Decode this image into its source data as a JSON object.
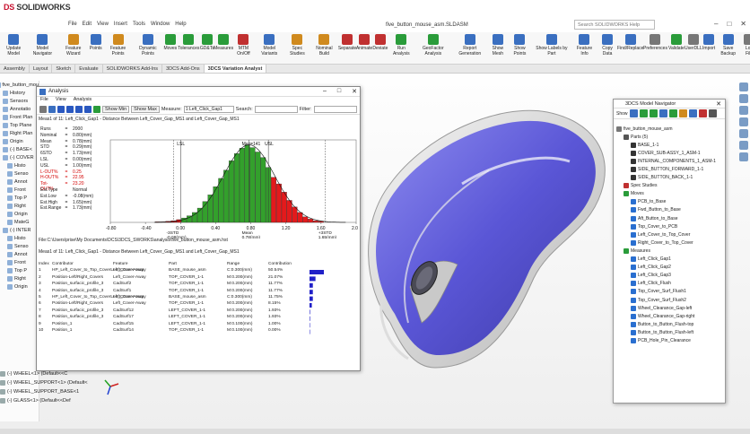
{
  "app": {
    "brand": "SOLIDWORKS",
    "doc_title": "five_button_mouse_asm.SLDASM",
    "search_placeholder": "Search SOLIDWORKS Help"
  },
  "menu": [
    "File",
    "Edit",
    "View",
    "Insert",
    "Tools",
    "Window",
    "Help"
  ],
  "ribbon": [
    {
      "label": "Update Model",
      "icon": "update-icon",
      "color": "#3a6fc0"
    },
    {
      "label": "Model Navigator",
      "icon": "navigator-icon",
      "color": "#3a6fc0"
    },
    {
      "label": "Feature Wizard",
      "icon": "wizard-icon",
      "color": "#d08a1e"
    },
    {
      "label": "Points",
      "icon": "points-icon",
      "color": "#3a6fc0"
    },
    {
      "label": "Feature Points",
      "icon": "feature-points-icon",
      "color": "#d08a1e"
    },
    {
      "label": "Dynamic Points",
      "icon": "dynamic-points-icon",
      "color": "#3a6fc0"
    },
    {
      "label": "Moves",
      "icon": "moves-icon",
      "color": "#2a9c3a"
    },
    {
      "label": "Tolerances",
      "icon": "tolerances-icon",
      "color": "#2a9c3a"
    },
    {
      "label": "GD&Ts",
      "icon": "gdt-icon",
      "color": "#2a9c3a"
    },
    {
      "label": "Measures",
      "icon": "measures-icon",
      "color": "#2a9c3a"
    },
    {
      "label": "MTM On/Off",
      "icon": "mtm-icon",
      "color": "#c03030"
    },
    {
      "label": "Model Variants",
      "icon": "variants-icon",
      "color": "#3a6fc0"
    },
    {
      "label": "Spec Studies",
      "icon": "spec-icon",
      "color": "#d08a1e"
    },
    {
      "label": "Nominal Build",
      "icon": "nominal-icon",
      "color": "#d08a1e"
    },
    {
      "label": "Separate",
      "icon": "separate-icon",
      "color": "#c03030"
    },
    {
      "label": "Animate",
      "icon": "animate-icon",
      "color": "#c03030"
    },
    {
      "label": "Deviate",
      "icon": "deviate-icon",
      "color": "#c03030"
    },
    {
      "label": "Run Analysis",
      "icon": "run-icon",
      "color": "#2a9c3a"
    },
    {
      "label": "GeoFactor Analysis",
      "icon": "geofactor-icon",
      "color": "#2a9c3a"
    },
    {
      "label": "Report Generation",
      "icon": "report-icon",
      "color": "#3a6fc0"
    },
    {
      "label": "Show Mesh",
      "icon": "mesh-icon",
      "color": "#3a6fc0"
    },
    {
      "label": "Show Points",
      "icon": "show-points-icon",
      "color": "#3a6fc0"
    },
    {
      "label": "Show Labels by Part",
      "icon": "labels-icon",
      "color": "#3a6fc0"
    },
    {
      "label": "Feature Info",
      "icon": "info-icon",
      "color": "#3a6fc0"
    },
    {
      "label": "Copy Data",
      "icon": "copy-icon",
      "color": "#3a6fc0"
    },
    {
      "label": "Find/Replace",
      "icon": "find-icon",
      "color": "#3a6fc0"
    },
    {
      "label": "Preferences",
      "icon": "preferences-icon",
      "color": "#777777"
    },
    {
      "label": "Validate",
      "icon": "validate-icon",
      "color": "#2a9c3a"
    },
    {
      "label": "UserDLL",
      "icon": "userdll-icon",
      "color": "#777777"
    },
    {
      "label": "Import",
      "icon": "import-icon",
      "color": "#3a6fc0"
    },
    {
      "label": "Save Backup",
      "icon": "save-icon",
      "color": "#3a6fc0"
    },
    {
      "label": "Log File",
      "icon": "log-icon",
      "color": "#777777"
    },
    {
      "label": "Write to Excel",
      "icon": "excel-icon",
      "color": "#2a9c3a"
    },
    {
      "label": "Help",
      "icon": "help-icon",
      "color": "#3a6fc0"
    },
    {
      "label": "About",
      "icon": "about-icon",
      "color": "#3a6fc0"
    }
  ],
  "tabs": [
    "Assembly",
    "Layout",
    "Sketch",
    "Evaluate",
    "SOLIDWORKS Add-Ins",
    "3DCS Add-Ons",
    "3DCS Variation Analyst"
  ],
  "tree": {
    "root": "five_button_mou",
    "items": [
      "History",
      "Sensors",
      "Annotatio",
      "Front Plan",
      "Top Plane",
      "Right Plan",
      "Origin",
      "(-) BASE<",
      "(-) COVER",
      "Histo",
      "Senso",
      "Annot",
      "Front",
      "Top P",
      "Right",
      "Origin",
      "MateG",
      "(-) INTER",
      "Histo",
      "Senso",
      "Annot",
      "Front",
      "Top P",
      "Right",
      "Origin"
    ],
    "bottom": [
      "(-) WHEEL<1>  (Default<<C",
      "(-) WHEEL_SUPPORT<1>  (Default<",
      "(-) WHEEL_SUPPORT_BASE<1",
      "(-) GLASS<1>  (Default<<Def"
    ]
  },
  "analysis": {
    "title": "Analysis",
    "menu": [
      "File",
      "View",
      "Analysis"
    ],
    "show_min": "Show Min",
    "show_max": "Show Max",
    "measure_label": "Measure:",
    "measure_value": "1:Left_Click_Gap1",
    "search_label": "Search:",
    "filter_label": "Filter:",
    "meas_title": "Meas1 of 11: Left_Click_Gap1 - Distance Between Left_Cover_Gap_MS1 and Left_Cover_Gap_MS1",
    "stats": [
      {
        "k": "Runs",
        "op": "=",
        "v": "2000",
        "red": false
      },
      {
        "k": "Nominal",
        "op": "=",
        "v": "0.80(mm)",
        "red": false
      },
      {
        "k": "Mean",
        "op": "=",
        "v": "0.78(mm)",
        "red": false
      },
      {
        "k": "STD",
        "op": "=",
        "v": "0.29(mm)",
        "red": false
      },
      {
        "k": "6STD",
        "op": "=",
        "v": "1.73(mm)",
        "red": false
      },
      {
        "k": "LSL",
        "op": "=",
        "v": "0.00(mm)",
        "red": false
      },
      {
        "k": "USL",
        "op": "=",
        "v": "1.00(mm)",
        "red": false
      },
      {
        "k": "L-OUT%",
        "op": "=",
        "v": "0.25",
        "red": true
      },
      {
        "k": "H-OUT%",
        "op": "=",
        "v": "22.95",
        "red": true
      },
      {
        "k": "Tot-OUT%",
        "op": "=",
        "v": "23.20",
        "red": true
      },
      {
        "k": "Est.Type",
        "op": "",
        "v": "Normal",
        "red": false
      },
      {
        "k": "Est.Low",
        "op": "=",
        "v": "-0.08(mm)",
        "red": false
      },
      {
        "k": "Est.High",
        "op": "=",
        "v": "1.65(mm)",
        "red": false
      },
      {
        "k": "Est.Range",
        "op": "=",
        "v": "1.73(mm)",
        "red": false
      }
    ],
    "file_path": "File:C:\\Users\\prise\\My Documents\\DCS\\3DCS_SWORKS\\analysis\\five_button_mouse_asm.hst",
    "contrib_title": "Meas1 of 11: Left_Click_Gap1 - Distance Between Left_Cover_Gap_MS1 and Left_Cover_Gap_MS1",
    "contrib_headers": [
      "Index",
      "Contributor",
      "Feature",
      "Part",
      "Range",
      "Contribution"
    ],
    "contrib_rows": [
      [
        "1",
        "HP_Left_Cover_to_Top_CoverLeft_Cover-Away",
        "Left_Cover-Away",
        "BASE_mouse_asm",
        "C:0.300(mm)",
        "50.54%"
      ],
      [
        "2",
        "Position-Left/Right_Covers",
        "Left_Cover-Away",
        "TOP_COVER_1-1",
        "M:0.200(mm)",
        "21.07%"
      ],
      [
        "3",
        "Position_surfacic_profile_3",
        "CadSurf2",
        "TOP_COVER_1-1",
        "M:0.200(mm)",
        "11.77%"
      ],
      [
        "4",
        "Position_surfacic_profile_3",
        "CadSurf1",
        "TOP_COVER_1-1",
        "M:0.200(mm)",
        "11.77%"
      ],
      [
        "5",
        "HP_Left_Cover_to_Top_CoverLeft_Cover-Away",
        "Left_Cover-Away",
        "BASE_mouse_asm",
        "C:0.300(mm)",
        "11.75%"
      ],
      [
        "6",
        "Position-Left/Right_Covers",
        "Left_Cover-Away",
        "TOP_COVER_1-1",
        "M:0.200(mm)",
        "8.15%"
      ],
      [
        "7",
        "Position_surfacic_profile_3",
        "CadSurf12",
        "LEFT_COVER_1-1",
        "M:0.200(mm)",
        "1.93%"
      ],
      [
        "8",
        "Position_surfacic_profile_3",
        "CadSurf17",
        "LEFT_COVER_1-1",
        "M:0.200(mm)",
        "1.93%"
      ],
      [
        "9",
        "Position_1",
        "CadSurf15",
        "LEFT_COVER_1-1",
        "M:0.100(mm)",
        "1.00%"
      ],
      [
        "10",
        "Position_1",
        "CadSurf14",
        "TOP_COVER_1-1",
        "M:0.100(mm)",
        "0.00%"
      ]
    ],
    "contrib_bars": [
      50.54,
      21.07,
      11.77,
      11.77,
      11.75,
      8.15,
      1.93,
      1.93,
      1.0,
      0.0
    ]
  },
  "chart_data": {
    "type": "bar",
    "title": "",
    "xlim": [
      -0.8,
      2.0
    ],
    "x_ticks": [
      "-0.80",
      "-0.40",
      "0.00",
      "0.40",
      "0.80",
      "1.20",
      "1.60",
      "2.00"
    ],
    "markers": [
      {
        "label": "LSL",
        "x": 0.0
      },
      {
        "label": "Max=141",
        "x": 0.78
      },
      {
        "label": "USL",
        "x": 1.0
      },
      {
        "label": "-3STD",
        "x": -0.08
      },
      {
        "label": "+3STD",
        "x": 1.65
      },
      {
        "label": "Mean",
        "x": 0.78
      }
    ],
    "bottom_labels": [
      "-3STD",
      "Mean",
      "+3STD",
      "-0.08(mm)",
      "0.78(mm)",
      "1.65(mm)"
    ],
    "bins_center": [
      -0.26,
      -0.2,
      -0.14,
      -0.08,
      -0.02,
      0.04,
      0.1,
      0.16,
      0.22,
      0.28,
      0.34,
      0.4,
      0.46,
      0.52,
      0.58,
      0.64,
      0.7,
      0.76,
      0.82,
      0.88,
      0.94,
      1.0,
      1.06,
      1.12,
      1.18,
      1.24,
      1.3,
      1.36,
      1.42,
      1.48,
      1.54,
      1.6
    ],
    "counts": [
      1,
      1,
      2,
      3,
      5,
      8,
      12,
      18,
      26,
      38,
      50,
      65,
      80,
      95,
      112,
      125,
      135,
      141,
      136,
      128,
      118,
      100,
      82,
      70,
      55,
      40,
      28,
      18,
      10,
      6,
      3,
      2
    ],
    "colors": {
      "in": "#33a02c",
      "out": "#e31a1c"
    }
  },
  "navigator": {
    "title": "3DCS Model Navigator",
    "show_label": "Show",
    "root": "five_button_mouse_asm",
    "rows": [
      {
        "label": "Parts (5)",
        "indent": 1,
        "color": "#555555"
      },
      {
        "label": "BASE_1-1",
        "indent": 2,
        "color": "#333333"
      },
      {
        "label": "COVER_SUB-ASSY_1_ASM-1",
        "indent": 2,
        "color": "#333333"
      },
      {
        "label": "INTERNAL_COMPONENTS_1_ASM-1",
        "indent": 2,
        "color": "#333333"
      },
      {
        "label": "SIDE_BUTTON_FORWARD_1-1",
        "indent": 2,
        "color": "#333333"
      },
      {
        "label": "SIDE_BUTTON_BACK_1-1",
        "indent": 2,
        "color": "#333333"
      },
      {
        "label": "Spec Studies",
        "indent": 1,
        "color": "#c03030"
      },
      {
        "label": "Moves",
        "indent": 1,
        "color": "#2a9c3a"
      },
      {
        "label": "PCB_to_Base",
        "indent": 2,
        "color": "#2a6fd0"
      },
      {
        "label": "Fwd_Button_to_Base",
        "indent": 2,
        "color": "#2a6fd0"
      },
      {
        "label": "Aft_Button_to_Base",
        "indent": 2,
        "color": "#2a6fd0"
      },
      {
        "label": "Top_Cover_to_PCB",
        "indent": 2,
        "color": "#2a6fd0"
      },
      {
        "label": "Left_Cover_to_Top_Cover",
        "indent": 2,
        "color": "#2a6fd0"
      },
      {
        "label": "Right_Cover_to_Top_Cover",
        "indent": 2,
        "color": "#2a6fd0"
      },
      {
        "label": "Measures",
        "indent": 1,
        "color": "#2a9c3a"
      },
      {
        "label": "Left_Click_Gap1",
        "indent": 2,
        "color": "#2a6fd0"
      },
      {
        "label": "Left_Click_Gap2",
        "indent": 2,
        "color": "#2a6fd0"
      },
      {
        "label": "Left_Click_Gap3",
        "indent": 2,
        "color": "#2a6fd0"
      },
      {
        "label": "Left_Click_Flush",
        "indent": 2,
        "color": "#2a6fd0"
      },
      {
        "label": "Top_Cover_Surf_Flush1",
        "indent": 2,
        "color": "#2a6fd0"
      },
      {
        "label": "Top_Cover_Surf_Flush2",
        "indent": 2,
        "color": "#2a6fd0"
      },
      {
        "label": "Wheel_Clearance_Gap-left",
        "indent": 2,
        "color": "#2a6fd0"
      },
      {
        "label": "Wheel_Clearance_Gap-right",
        "indent": 2,
        "color": "#2a6fd0"
      },
      {
        "label": "Button_to_Button_Flush-top",
        "indent": 2,
        "color": "#2a6fd0"
      },
      {
        "label": "Button_to_Button_Flush-left",
        "indent": 2,
        "color": "#2a6fd0"
      },
      {
        "label": "PCB_Hole_Pin_Clearance",
        "indent": 2,
        "color": "#2a6fd0"
      }
    ]
  }
}
